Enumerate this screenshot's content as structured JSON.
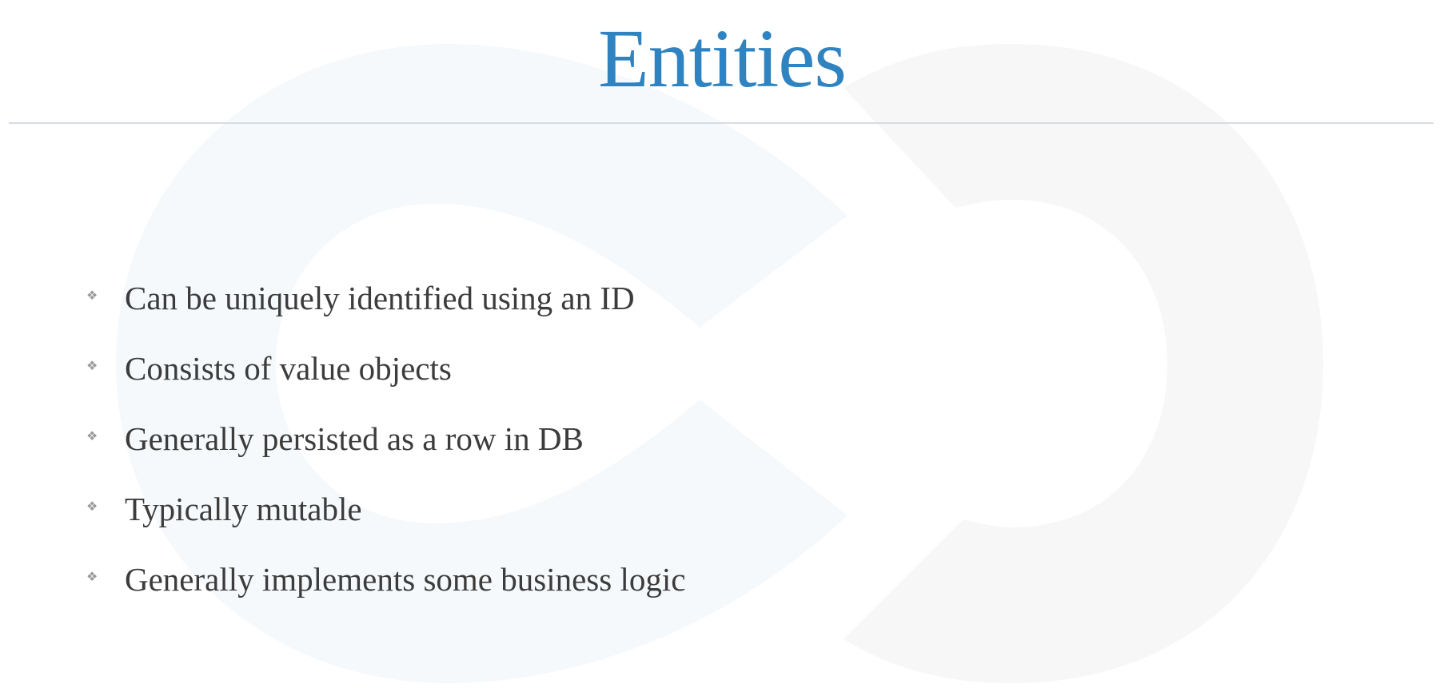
{
  "slide": {
    "title": "Entities",
    "bullet_icon": "diamond-bullet-icon",
    "bullets": [
      "Can be uniquely identified using an ID",
      "Consists of value objects",
      "Generally persisted as a row in DB",
      "Typically mutable",
      "Generally implements some business logic"
    ]
  },
  "theme": {
    "title_color": "#2f83c0",
    "text_color": "#3c3c3c",
    "bullet_color": "#9a9a9a",
    "watermark_left_color": "#f6f9fc",
    "watermark_right_color": "#f7f7f7"
  }
}
